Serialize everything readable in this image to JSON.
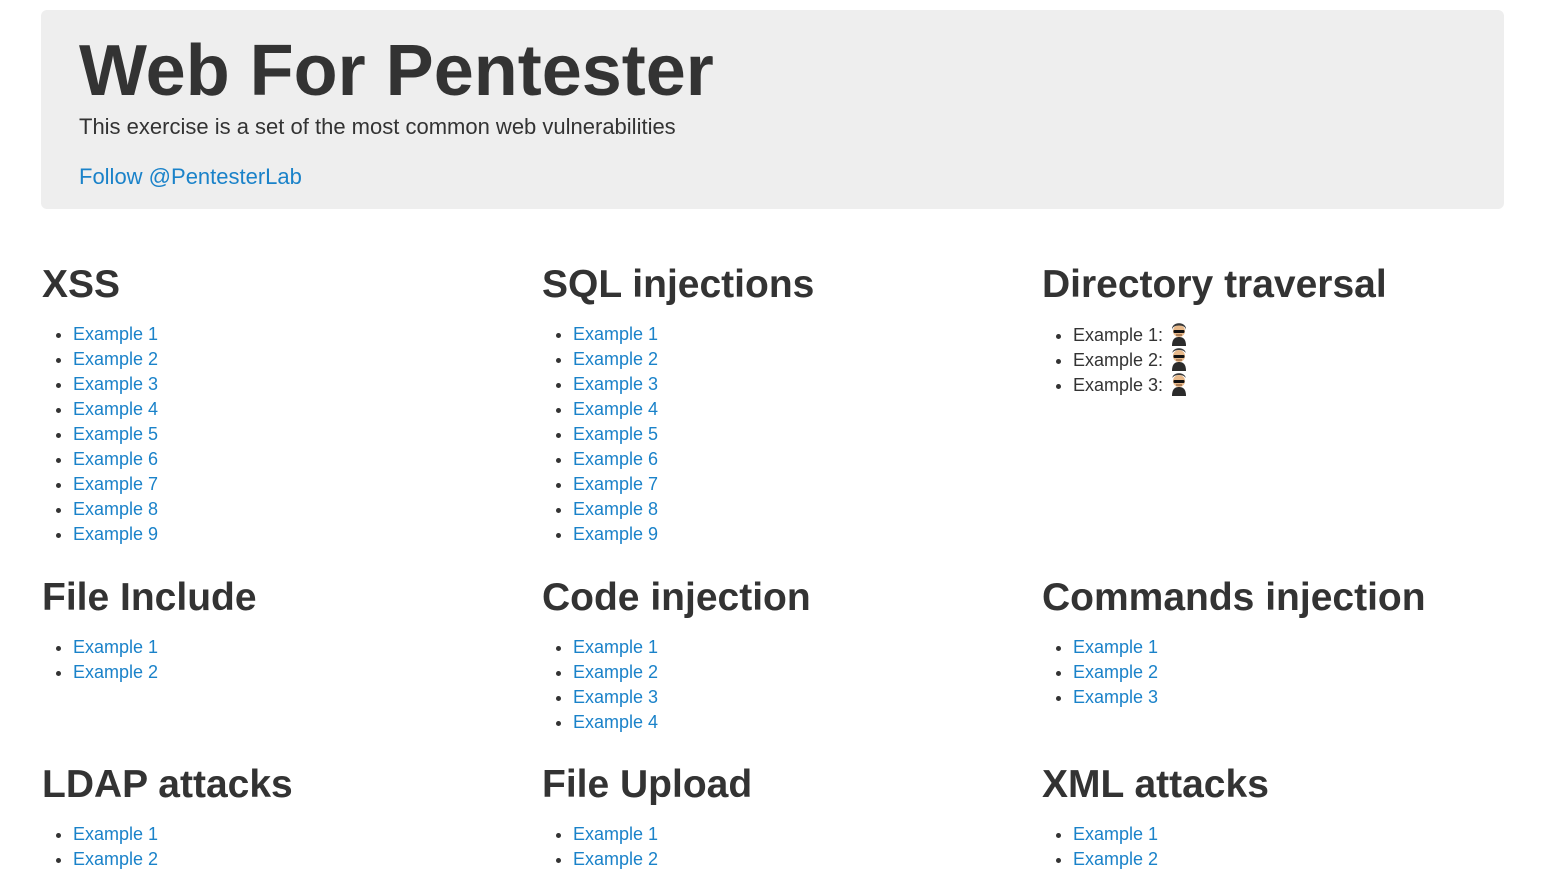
{
  "header": {
    "title": "Web For Pentester",
    "subtitle": "This exercise is a set of the most common web vulnerabilities",
    "follow_link": "Follow @PentesterLab"
  },
  "sections": [
    {
      "title": "XSS",
      "items": [
        "Example 1",
        "Example 2",
        "Example 3",
        "Example 4",
        "Example 5",
        "Example 6",
        "Example 7",
        "Example 8",
        "Example 9"
      ]
    },
    {
      "title": "SQL injections",
      "items": [
        "Example 1",
        "Example 2",
        "Example 3",
        "Example 4",
        "Example 5",
        "Example 6",
        "Example 7",
        "Example 8",
        "Example 9"
      ]
    },
    {
      "title": "Directory traversal",
      "items": [
        "Example 1:",
        "Example 2:",
        "Example 3:"
      ],
      "item_icon": "hacker-icon"
    },
    {
      "title": "File Include",
      "items": [
        "Example 1",
        "Example 2"
      ]
    },
    {
      "title": "Code injection",
      "items": [
        "Example 1",
        "Example 2",
        "Example 3",
        "Example 4"
      ]
    },
    {
      "title": "Commands injection",
      "items": [
        "Example 1",
        "Example 2",
        "Example 3"
      ]
    },
    {
      "title": "LDAP attacks",
      "items": [
        "Example 1",
        "Example 2"
      ]
    },
    {
      "title": "File Upload",
      "items": [
        "Example 1",
        "Example 2"
      ]
    },
    {
      "title": "XML attacks",
      "items": [
        "Example 1",
        "Example 2"
      ]
    }
  ],
  "colors": {
    "link": "#1a82c9",
    "text": "#333333",
    "hero_background": "#eeeeee"
  }
}
